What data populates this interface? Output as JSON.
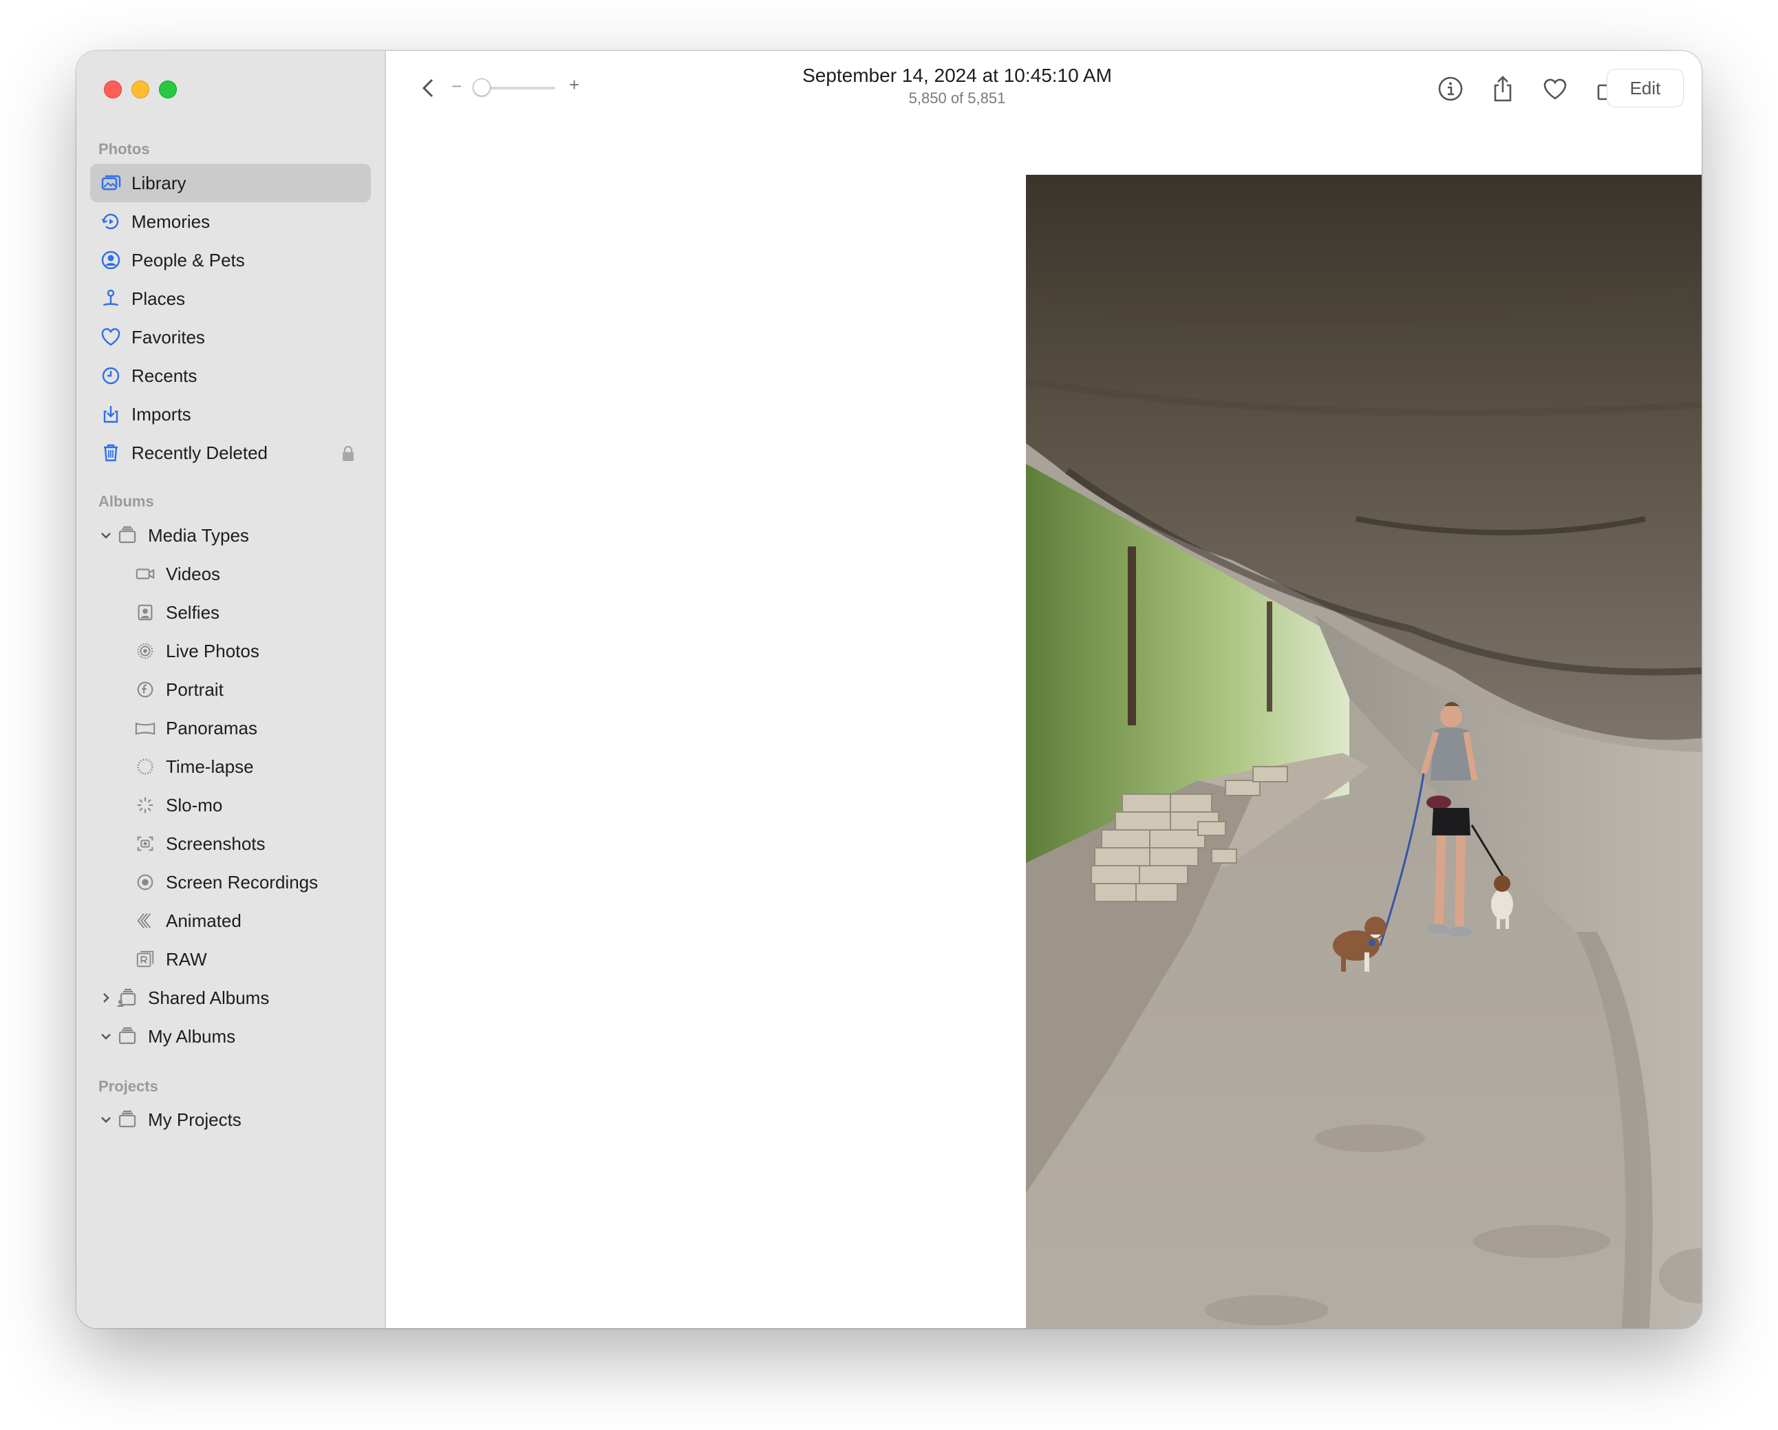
{
  "window": {
    "title": "September 14, 2024 at 10:45:10 AM",
    "subtitle": "5,850 of 5,851",
    "edit_label": "Edit",
    "zoom_minus": "−",
    "zoom_plus": "+"
  },
  "sidebar": {
    "photos_title": "Photos",
    "photos_items": [
      {
        "label": "Library",
        "icon": "library-icon",
        "selected": true
      },
      {
        "label": "Memories",
        "icon": "memories-icon"
      },
      {
        "label": "People & Pets",
        "icon": "people-icon"
      },
      {
        "label": "Places",
        "icon": "places-icon"
      },
      {
        "label": "Favorites",
        "icon": "heart-icon"
      },
      {
        "label": "Recents",
        "icon": "clock-icon"
      },
      {
        "label": "Imports",
        "icon": "imports-icon"
      },
      {
        "label": "Recently Deleted",
        "icon": "trash-icon",
        "locked": true
      }
    ],
    "albums_title": "Albums",
    "media_types_label": "Media Types",
    "media_items": [
      {
        "label": "Videos",
        "icon": "video-icon"
      },
      {
        "label": "Selfies",
        "icon": "selfie-icon"
      },
      {
        "label": "Live Photos",
        "icon": "live-photo-icon"
      },
      {
        "label": "Portrait",
        "icon": "portrait-icon"
      },
      {
        "label": "Panoramas",
        "icon": "panorama-icon"
      },
      {
        "label": "Time-lapse",
        "icon": "timelapse-icon"
      },
      {
        "label": "Slo-mo",
        "icon": "slomo-icon"
      },
      {
        "label": "Screenshots",
        "icon": "screenshot-icon"
      },
      {
        "label": "Screen Recordings",
        "icon": "screen-recording-icon"
      },
      {
        "label": "Animated",
        "icon": "animated-icon"
      },
      {
        "label": "RAW",
        "icon": "raw-icon"
      }
    ],
    "shared_albums_label": "Shared Albums",
    "my_albums_label": "My Albums",
    "projects_title": "Projects",
    "my_projects_label": "My Projects"
  },
  "colors": {
    "accent": "#2f6fe8",
    "sidebar_bg": "#e4e4e4",
    "selected_bg": "#cbcbcb"
  }
}
